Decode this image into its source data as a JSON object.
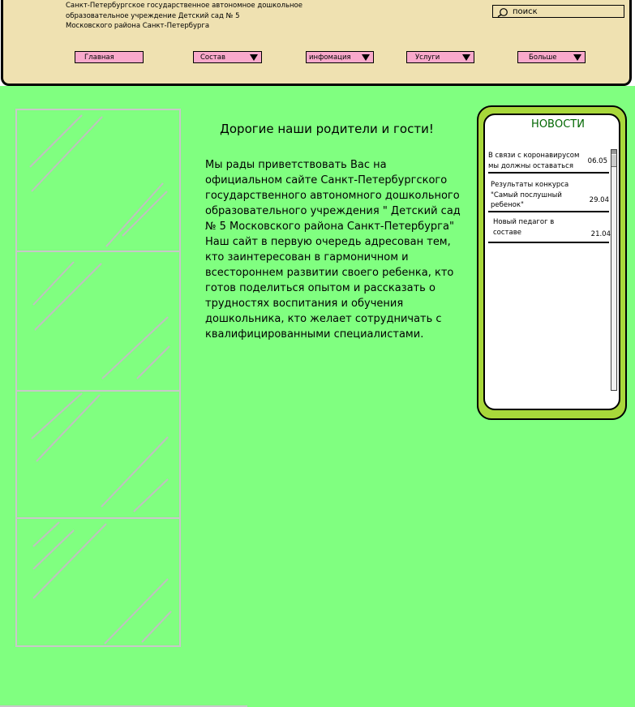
{
  "header": {
    "org_name_lines": [
      "Санкт-Петербургское государственное автономное дошкольное",
      "образовательное учреждение Детский сад № 5",
      "Московского района Санкт-Петербурга"
    ],
    "search": {
      "placeholder": "поиск",
      "value": ""
    },
    "nav": [
      {
        "label": "Главная",
        "has_dropdown": false
      },
      {
        "label": "Состав",
        "has_dropdown": true
      },
      {
        "label": "инфомация",
        "has_dropdown": true
      },
      {
        "label": "Услуги",
        "has_dropdown": true
      },
      {
        "label": "Больше",
        "has_dropdown": true
      }
    ]
  },
  "welcome": {
    "title": "Дорогие наши родители и гости!",
    "text": "Мы рады приветствовать Вас на официальном сайте Санкт-Петербургского государственного автономного дошкольного образовательного учреждения \" Детский сад № 5 Московского района Санкт-Петербурга\" Наш сайт в первую очередь адресован тем, кто заинтересован в гармоничном и всестороннем развитии своего ребенка, кто готов поделиться опытом и рассказать о трудностях воспитания и обучения дошкольника, кто желает сотрудничать с квалифицированными специалистами."
  },
  "news": {
    "title": "НОВОСТИ",
    "items": [
      {
        "text_lines": [
          "В связи с коронавирусом",
          "мы должны оставаться"
        ],
        "date": "06.05"
      },
      {
        "text_lines": [
          "Результаты конкурса",
          "\"Самый послушный",
          "ребенок\""
        ],
        "date": "29.04"
      },
      {
        "text_lines": [
          "Новый педагог в",
          "составе"
        ],
        "date": "21.04"
      }
    ]
  },
  "colors": {
    "header_bg": "#efe1b1",
    "main_bg": "#80ff80",
    "nav_button_bg": "#f9a9cb",
    "news_border": "#a8d83a",
    "news_title": "#006600",
    "gallery_frame": "#c8c8c8"
  },
  "icons": {
    "search": "magnifier-icon",
    "dropdown": "triangle-down-icon"
  }
}
